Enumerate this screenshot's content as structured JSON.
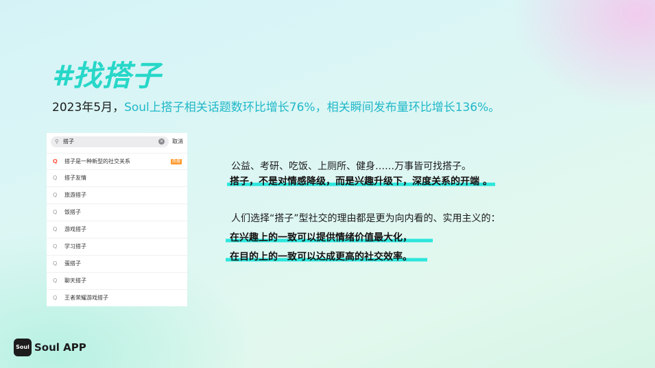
{
  "title": "#找搭子",
  "subtitle": {
    "prefix": "2023年5月，",
    "highlight": "Soul上搭子相关话题数环比增长76%，相关瞬间发布量环比增长136%。"
  },
  "search_panel": {
    "query": "搭子",
    "cancel_label": "取消",
    "suggestions": [
      {
        "text": "搭子是一种新型的社交关系",
        "badge": "热搜",
        "hot": true
      },
      {
        "text": "搭子友情"
      },
      {
        "text": "旅游搭子"
      },
      {
        "text": "饭搭子"
      },
      {
        "text": "游戏搭子"
      },
      {
        "text": "学习搭子"
      },
      {
        "text": "蛋搭子"
      },
      {
        "text": "聊天搭子"
      },
      {
        "text": "王者荣耀游戏搭子"
      }
    ]
  },
  "text_block_1": {
    "line1": "公益、考研、吃饭、上厕所、健身……万事皆可找搭子。",
    "line2": "搭子，不是对情感降级，而是兴趣升级下，深度关系的开端 。"
  },
  "text_block_2": {
    "line1": "人们选择“搭子”型社交的理由都是更为向内看的、实用主义的：",
    "line2": "在兴趣上的一致可以提供情绪价值最大化，",
    "line3": "在目的上的一致可以达成更高的社交效率。"
  },
  "logo": {
    "badge": "Soul",
    "text": "Soul APP"
  },
  "colors": {
    "accent": "#27d7c8",
    "highlight_bar": "#2ce6dc",
    "link_text": "#20b8c8"
  }
}
